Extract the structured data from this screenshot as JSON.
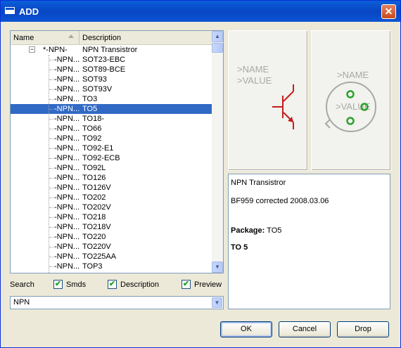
{
  "window": {
    "title": "ADD",
    "close_symbol": "✕"
  },
  "list": {
    "columns": [
      "Name",
      "Description"
    ],
    "root": {
      "name": "*-NPN-",
      "description": "NPN Transistror",
      "expander": "−"
    },
    "rows": [
      {
        "name": "-NPN...",
        "description": "SOT23-EBC"
      },
      {
        "name": "-NPN...",
        "description": "SOT89-BCE"
      },
      {
        "name": "-NPN...",
        "description": "SOT93"
      },
      {
        "name": "-NPN...",
        "description": "SOT93V"
      },
      {
        "name": "-NPN...",
        "description": "TO3"
      },
      {
        "name": "-NPN...",
        "description": "TO5"
      },
      {
        "name": "-NPN...",
        "description": "TO18-"
      },
      {
        "name": "-NPN...",
        "description": "TO66"
      },
      {
        "name": "-NPN...",
        "description": "TO92"
      },
      {
        "name": "-NPN...",
        "description": "TO92-E1"
      },
      {
        "name": "-NPN...",
        "description": "TO92-ECB"
      },
      {
        "name": "-NPN...",
        "description": "TO92L"
      },
      {
        "name": "-NPN...",
        "description": "TO126"
      },
      {
        "name": "-NPN...",
        "description": "TO126V"
      },
      {
        "name": "-NPN...",
        "description": "TO202"
      },
      {
        "name": "-NPN...",
        "description": "TO202V"
      },
      {
        "name": "-NPN...",
        "description": "TO218"
      },
      {
        "name": "-NPN...",
        "description": "TO218V"
      },
      {
        "name": "-NPN...",
        "description": "TO220"
      },
      {
        "name": "-NPN...",
        "description": "TO220V"
      },
      {
        "name": "-NPN...",
        "description": "TO225AA"
      },
      {
        "name": "-NPN...",
        "description": "TOP3"
      }
    ],
    "selected_index": 5,
    "scroll_up": "▲",
    "scroll_down": "▼"
  },
  "search": {
    "label": "Search",
    "checkboxes": [
      {
        "label": "Smds",
        "checked": true
      },
      {
        "label": "Description",
        "checked": true
      },
      {
        "label": "Preview",
        "checked": true
      }
    ],
    "check_mark": "✔",
    "value": "NPN",
    "dropdown_arrow": "▼"
  },
  "symbol_preview": {
    "name": ">NAME",
    "value": ">VALUE",
    "line_color": "#c41e1e"
  },
  "package_preview": {
    "name": ">NAME",
    "value": ">VALUE",
    "pad_color": "#2ea12e"
  },
  "description": {
    "line1": "NPN Transistror",
    "line2": "BF959 corrected 2008.03.06",
    "package_label": "Package:",
    "package_value": " TO5",
    "heading": "TO 5"
  },
  "buttons": {
    "ok": "OK",
    "cancel": "Cancel",
    "drop": "Drop"
  }
}
